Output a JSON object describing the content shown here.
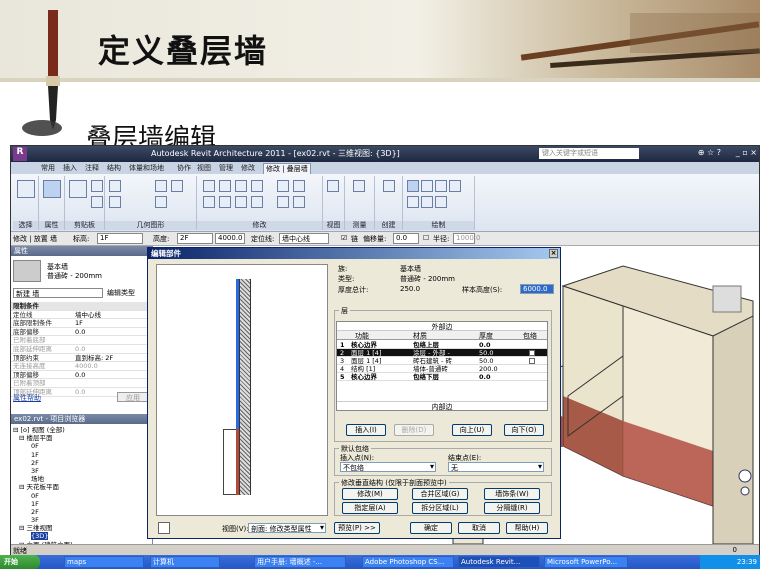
{
  "slide": {
    "title": "定义叠层墙",
    "subtitle": "叠层墙编辑"
  },
  "revit": {
    "title": "Autodesk Revit Architecture 2011 - [ex02.rvt - 三维视图: {3D}]",
    "search_placeholder": "键入关键字或短语",
    "tabs": [
      "常用",
      "插入",
      "注释",
      "结构",
      "体量和场地",
      "协作",
      "视图",
      "管理",
      "修改",
      "修改 | 叠层墙"
    ],
    "ribbon_panels": [
      "选择",
      "属性",
      "剪贴板",
      "几何图形",
      "修改",
      "视图",
      "测量",
      "创建",
      "绘制"
    ],
    "options_bar": {
      "modify": "修改 | 放置 墙",
      "level_label": "标高:",
      "level_value": "1F",
      "height_label": "高度:",
      "height_value": "2F",
      "height_num": "4000.0",
      "loc_label": "定位线:",
      "loc_value": "墙中心线",
      "chain_label": "链",
      "offset_label": "偏移量:",
      "offset_value": "0.0",
      "radius_label": "半径:",
      "radius_value": "1000.0"
    }
  },
  "properties": {
    "header": "属性",
    "type_line1": "基本墙",
    "type_line2": "普通砖 - 200mm",
    "new_wall": "新建 墙",
    "edit_type": "编辑类型",
    "rows": [
      {
        "k": "限制条件",
        "v": "",
        "cls": "sec"
      },
      {
        "k": "定位线",
        "v": "墙中心线",
        "cls": ""
      },
      {
        "k": "底部限制条件",
        "v": "1F",
        "cls": ""
      },
      {
        "k": "底部偏移",
        "v": "0.0",
        "cls": ""
      },
      {
        "k": "已附着底部",
        "v": "",
        "cls": "dim"
      },
      {
        "k": "底部延伸距离",
        "v": "0.0",
        "cls": "dim"
      },
      {
        "k": "顶部约束",
        "v": "直到标高: 2F",
        "cls": ""
      },
      {
        "k": "无连接高度",
        "v": "4000.0",
        "cls": "dim"
      },
      {
        "k": "顶部偏移",
        "v": "0.0",
        "cls": ""
      },
      {
        "k": "已附着顶部",
        "v": "",
        "cls": "dim"
      },
      {
        "k": "顶部延伸距离",
        "v": "0.0",
        "cls": "dim"
      }
    ],
    "help": "属性帮助",
    "apply": "应用"
  },
  "browser": {
    "header": "ex02.rvt - 项目浏览器",
    "nodes": [
      {
        "t": "⊟ [o] 视图 (全部)",
        "d": 0
      },
      {
        "t": "⊟ 楼层平面",
        "d": 1
      },
      {
        "t": "0F",
        "d": 3
      },
      {
        "t": "1F",
        "d": 3
      },
      {
        "t": "2F",
        "d": 3
      },
      {
        "t": "3F",
        "d": 3
      },
      {
        "t": "场地",
        "d": 3
      },
      {
        "t": "⊟ 天花板平面",
        "d": 1
      },
      {
        "t": "0F",
        "d": 3
      },
      {
        "t": "1F",
        "d": 3
      },
      {
        "t": "2F",
        "d": 3
      },
      {
        "t": "3F",
        "d": 3
      },
      {
        "t": "⊟ 三维视图",
        "d": 1
      },
      {
        "t": "{3D}",
        "d": 3,
        "sel": true
      },
      {
        "t": "⊟ 立面 (建筑立面)",
        "d": 1
      }
    ]
  },
  "status": {
    "left": "就绪",
    "right": "0"
  },
  "dialog": {
    "title": "编辑部件",
    "family_label": "族:",
    "family_value": "基本墙",
    "type_label": "类型:",
    "type_value": "普通砖 - 200mm",
    "thick_label": "厚度总计:",
    "thick_value": "250.0",
    "sample_label": "样本高度(S):",
    "sample_value": "6000.0",
    "layers_group": "层",
    "exterior": "外部边",
    "interior": "内部边",
    "cols": [
      "功能",
      "材质",
      "厚度",
      "包络"
    ],
    "layers": [
      {
        "n": "1",
        "f": "核心边界",
        "m": "包络上层",
        "t": "0.0",
        "cls": "bold"
      },
      {
        "n": "2",
        "f": "面层 1 [4]",
        "m": "涂层 - 外部 -",
        "t": "50.0",
        "cls": "sel"
      },
      {
        "n": "3",
        "f": "面层 1 [4]",
        "m": "砖石建筑 - 砖",
        "t": "50.0",
        "cls": ""
      },
      {
        "n": "4",
        "f": "结构 [1]",
        "m": "墙体-普通砖",
        "t": "200.0",
        "cls": ""
      },
      {
        "n": "5",
        "f": "核心边界",
        "m": "包络下层",
        "t": "0.0",
        "cls": "bold"
      }
    ],
    "insert_btn": "插入(I)",
    "delete_btn": "删除(D)",
    "up_btn": "向上(U)",
    "down_btn": "向下(O)",
    "wrap_group": "默认包络",
    "insert_pt_label": "插入点(N):",
    "insert_pt_value": "不包络",
    "end_pt_label": "结束点(E):",
    "end_pt_value": "无",
    "vstruct_group": "修改垂直结构 (仅限于剖面预览中)",
    "modify_btn": "修改(M)",
    "merge_btn": "合并区域(G)",
    "sweep_btn": "墙饰条(W)",
    "assign_btn": "指定层(A)",
    "split_btn": "拆分区域(L)",
    "reveal_btn": "分隔缝(R)",
    "view_label": "视图(V):",
    "view_value": "剖面: 修改类型属性",
    "preview_btn": "预览(P) >>",
    "ok_btn": "确定",
    "cancel_btn": "取消",
    "help_btn": "帮助(H)"
  },
  "taskbar": {
    "start": "开始",
    "items": [
      "maps",
      "计算机",
      "用户手册: 墙概述 -...",
      "Adobe Photoshop CS...",
      "Autodesk Revit...",
      "Microsoft PowerPo..."
    ],
    "clock": "23:39"
  }
}
